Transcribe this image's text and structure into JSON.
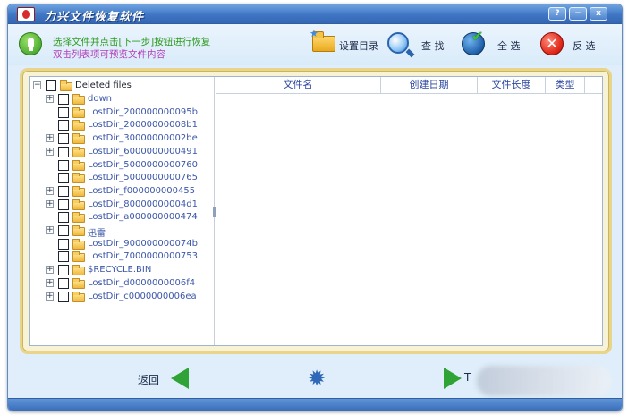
{
  "window": {
    "title": "力兴文件恢复软件",
    "controls": [
      "?",
      "−",
      "x"
    ]
  },
  "toolbar": {
    "hint_line1": "选择文件并点击[下一步]按钮进行恢复",
    "hint_line2": "双击列表项可预览文件内容",
    "set_dir_label": "设置目录",
    "find_label": "查 找",
    "select_all_label": "全 选",
    "invert_label": "反 选",
    "icons": [
      "folder-settings-icon",
      "search-icon",
      "globe-check-icon",
      "invert-x-icon"
    ]
  },
  "tree": {
    "root": "Deleted files",
    "items": [
      {
        "label": "down",
        "expandable": true
      },
      {
        "label": "LostDir_200000000095b",
        "expandable": false
      },
      {
        "label": "LostDir_20000000008b1",
        "expandable": false
      },
      {
        "label": "LostDir_30000000002be",
        "expandable": true
      },
      {
        "label": "LostDir_6000000000491",
        "expandable": true
      },
      {
        "label": "LostDir_5000000000760",
        "expandable": false
      },
      {
        "label": "LostDir_5000000000765",
        "expandable": false
      },
      {
        "label": "LostDir_f000000000455",
        "expandable": true
      },
      {
        "label": "LostDir_80000000004d1",
        "expandable": true
      },
      {
        "label": "LostDir_a000000000474",
        "expandable": false
      },
      {
        "label": "迅雷",
        "expandable": true
      },
      {
        "label": "LostDir_900000000074b",
        "expandable": false
      },
      {
        "label": "LostDir_7000000000753",
        "expandable": false
      },
      {
        "label": "$RECYCLE.BIN",
        "expandable": true
      },
      {
        "label": "LostDir_d0000000006f4",
        "expandable": true
      },
      {
        "label": "LostDir_c0000000006ea",
        "expandable": true
      }
    ]
  },
  "table": {
    "columns": [
      "文件名",
      "创建日期",
      "文件长度",
      "类型"
    ],
    "rows": []
  },
  "nav": {
    "back_label": "返回",
    "next_label": "T"
  }
}
